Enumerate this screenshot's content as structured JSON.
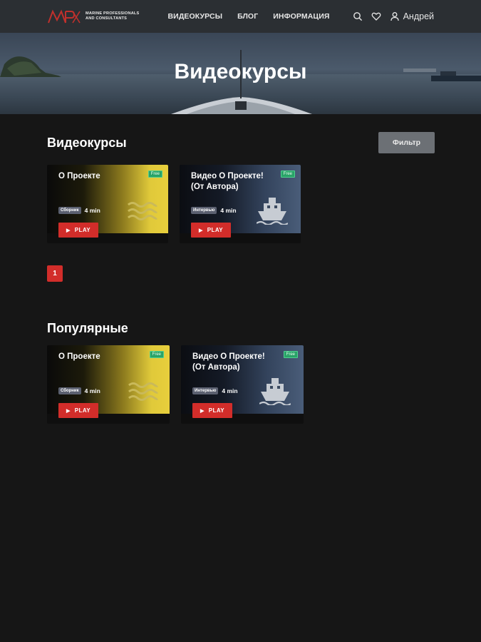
{
  "header": {
    "logo_line1": "Marine Professionals",
    "logo_line2": "and Consultants",
    "nav": [
      {
        "label": "ВИДЕОКУРСЫ"
      },
      {
        "label": "БЛОГ"
      },
      {
        "label": "ИНФОРМАЦИЯ"
      }
    ],
    "user_name": "Андрей"
  },
  "hero": {
    "title": "Видеокурсы"
  },
  "courses": {
    "title": "Видеокурсы",
    "filter_label": "Фильтр",
    "cards": [
      {
        "title": "О Проекте",
        "badge": "Free",
        "tag": "Сборник",
        "duration": "4 min",
        "play": "PLAY",
        "art": "waves-icon"
      },
      {
        "title": "Видео О Проекте! (От Автора)",
        "badge": "Free",
        "tag": "Интервью",
        "duration": "4 min",
        "play": "PLAY",
        "art": "ship-icon"
      }
    ],
    "page": "1"
  },
  "popular": {
    "title": "Популярные",
    "cards": [
      {
        "title": "О Проекте",
        "badge": "Free",
        "tag": "Сборник",
        "duration": "4 min",
        "play": "PLAY",
        "art": "waves-icon"
      },
      {
        "title": "Видео О Проекте! (От Автора)",
        "badge": "Free",
        "tag": "Интервью",
        "duration": "4 min",
        "play": "PLAY",
        "art": "ship-icon"
      }
    ]
  },
  "colors": {
    "background": "#161616",
    "header": "#2b2f33",
    "accent_red": "#d22d2a",
    "free_green": "#2aa368",
    "tag_gray": "#5b6070"
  }
}
